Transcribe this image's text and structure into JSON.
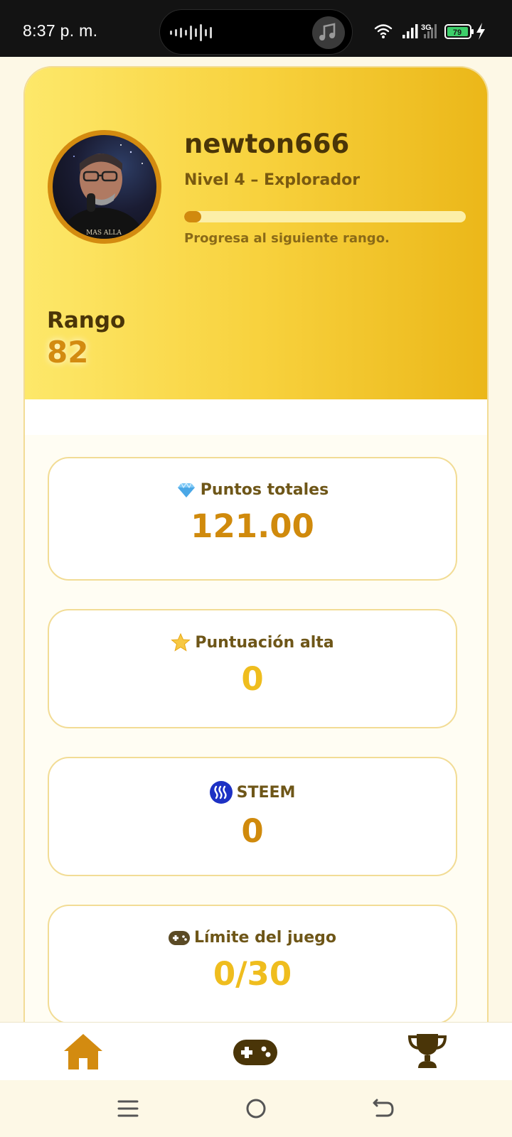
{
  "status_bar": {
    "time": "8:37 p. m.",
    "network": "3G",
    "battery": "79"
  },
  "profile": {
    "username": "newton666",
    "level": "Nivel 4 – Explorador",
    "progress_fraction": 0.06,
    "progress_text": "Progresa al siguiente rango.",
    "rank_label": "Rango",
    "rank_value": "82",
    "avatar_icon": "user-avatar"
  },
  "stats": [
    {
      "icon": "diamond-icon",
      "label": "Puntos totales",
      "value": "121.00"
    },
    {
      "icon": "star-icon",
      "label": "Puntuación alta",
      "value": "0"
    },
    {
      "icon": "steem-icon",
      "label": "STEEM",
      "value": "0"
    },
    {
      "icon": "gamepad-icon",
      "label": "Límite del juego",
      "value": "0/30"
    }
  ],
  "nav": {
    "items": [
      {
        "icon": "home-icon",
        "active": true
      },
      {
        "icon": "gamepad-icon",
        "active": false
      },
      {
        "icon": "trophy-icon",
        "active": false
      }
    ]
  },
  "colors": {
    "accent": "#d18a0e",
    "gold": "#efbd1e",
    "hero_start": "#fde86a",
    "hero_end": "#ebb719"
  }
}
